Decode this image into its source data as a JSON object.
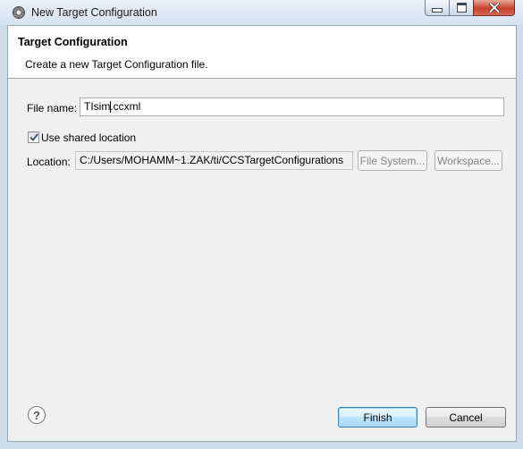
{
  "window": {
    "title": "New Target Configuration"
  },
  "banner": {
    "title": "Target Configuration",
    "description": "Create a new Target Configuration file."
  },
  "form": {
    "file_name_label": "File name:",
    "file_name_before_caret": "TIsim",
    "file_name_after_caret": ".ccxml",
    "use_shared_label": "Use shared location",
    "use_shared_checked": true,
    "location_label": "Location:",
    "location_value": "C:/Users/MOHAMM~1.ZAK/ti/CCSTargetConfigurations",
    "file_system_label": "File System...",
    "workspace_label": "Workspace..."
  },
  "footer": {
    "finish_label": "Finish",
    "cancel_label": "Cancel"
  },
  "icons": {
    "app": "eclipse-gear-icon",
    "help": "help-icon",
    "check": "checkmark-icon"
  }
}
